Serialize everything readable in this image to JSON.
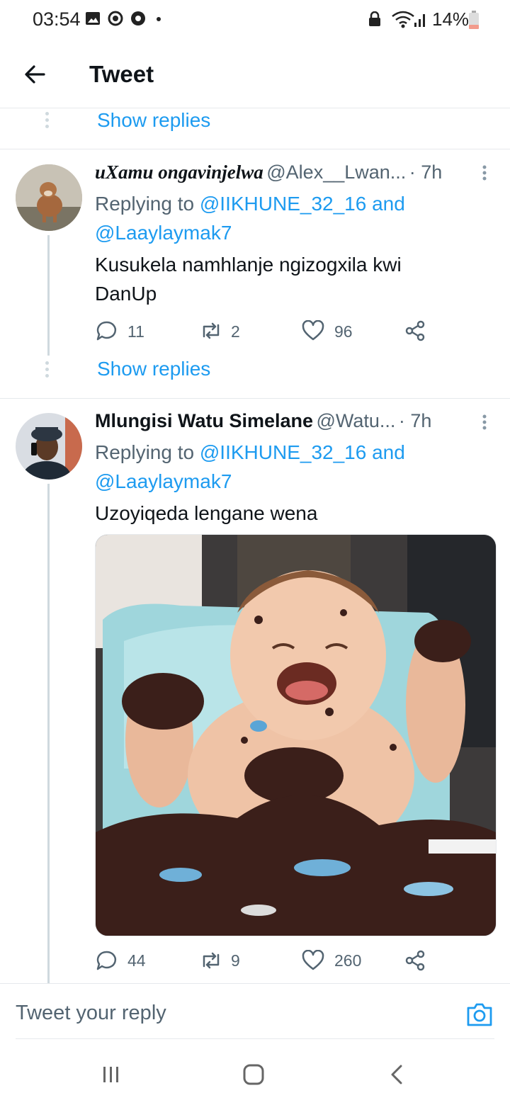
{
  "status_bar": {
    "time": "03:54",
    "battery": "14%"
  },
  "header": {
    "title": "Tweet"
  },
  "show_replies_label": "Show replies",
  "tweets": [
    {
      "name": "uXamu ongavinjelwa",
      "handle": "@Alex__Lwan...",
      "time": "· 7h",
      "replying_prefix": "Replying to",
      "mention_1": "@IIKHUNE_32_16",
      "and": "and",
      "mention_2": "@Laaylaymak7",
      "text_line1": "Kusukela namhlanje ngizogxila kwi",
      "text_line2": "DanUp",
      "replies": "11",
      "retweets": "2",
      "likes": "96"
    },
    {
      "name": "Mlungisi Watu Simelane",
      "handle": "@Watu...",
      "time": "· 7h",
      "replying_prefix": "Replying to",
      "mention_1": "@IIKHUNE_32_16",
      "and": "and",
      "mention_2": "@Laaylaymak7",
      "text_line1": "Uzoyiqeda lengane wena",
      "replies": "44",
      "retweets": "9",
      "likes": "260"
    }
  ],
  "reply_bar": {
    "placeholder": "Tweet your reply"
  },
  "colors": {
    "accent": "#1d9bf0",
    "secondary_text": "#536471"
  }
}
